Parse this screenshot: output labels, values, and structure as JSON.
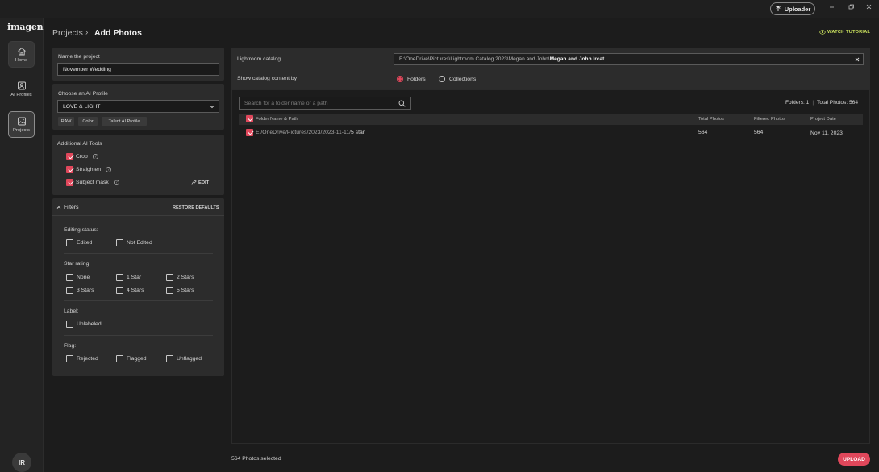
{
  "app": {
    "logo": "imagen",
    "uploader_label": "Uploader",
    "avatar_initials": "IR"
  },
  "rail": {
    "home": "Home",
    "ai_profiles": "AI Profiles",
    "projects": "Projects"
  },
  "header": {
    "breadcrumb_parent": "Projects",
    "breadcrumb_sep": "›",
    "breadcrumb_current": "Add Photos",
    "watch_tutorial": "WATCH TUTORIAL"
  },
  "project": {
    "name_label": "Name the project",
    "name_value": "November Wedding",
    "profile_label": "Choose an AI Profile",
    "profile_value": "LOVE & LIGHT",
    "chips": [
      "RAW",
      "Color",
      "Talent AI Profile"
    ]
  },
  "ai_tools": {
    "title": "Additional AI Tools",
    "items": [
      {
        "label": "Crop",
        "checked": true
      },
      {
        "label": "Straighten",
        "checked": true
      },
      {
        "label": "Subject mask",
        "checked": true
      }
    ],
    "edit_label": "EDIT"
  },
  "filters": {
    "title": "Filters",
    "restore": "RESTORE DEFAULTS",
    "editing_status_label": "Editing status:",
    "editing_status": [
      "Edited",
      "Not Edited"
    ],
    "star_rating_label": "Star rating:",
    "star_rating": [
      "None",
      "1 Star",
      "2 Stars",
      "3 Stars",
      "4 Stars",
      "5 Stars"
    ],
    "label_label": "Label:",
    "label_options": [
      "Unlabeled"
    ],
    "flag_label": "Flag:",
    "flag_options": [
      "Rejected",
      "Flagged",
      "Unflagged"
    ]
  },
  "catalog": {
    "label": "Lightroom catalog",
    "path_prefix": "E:\\OneDrive\\Pictures\\Lightroom Catalog 2023\\Megan and John\\",
    "path_file": "Megan and John.lrcat",
    "show_by_label": "Show catalog content by",
    "options": [
      "Folders",
      "Collections"
    ],
    "selected": "Folders"
  },
  "table": {
    "search_placeholder": "Search for a folder name or a path",
    "summary_folders": "Folders: 1",
    "summary_sep": "|",
    "summary_total": "Total Photos: 564",
    "columns": [
      "Folder Name & Path",
      "Total Photos",
      "Filtered Photos",
      "Project Date"
    ],
    "rows": [
      {
        "path_prefix": "E:/OneDrive/Pictures/2023/2023-11-11/",
        "path_name": "5 star",
        "total": "564",
        "filtered": "564",
        "date": "Nov 11, 2023",
        "checked": true
      }
    ]
  },
  "footer": {
    "selected_text": "564 Photos selected",
    "upload_label": "UPLOAD"
  },
  "colors": {
    "accent": "#e0475b",
    "tutorial": "#c8df5d"
  }
}
